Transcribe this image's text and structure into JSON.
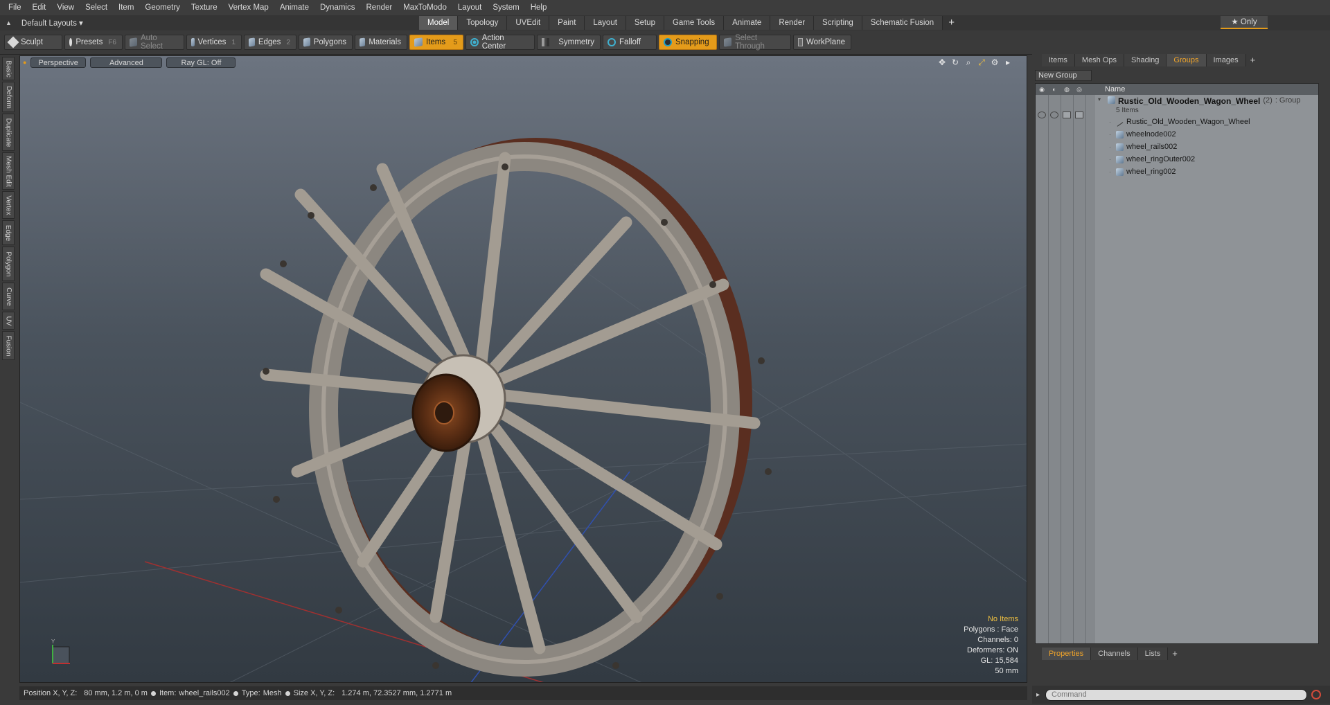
{
  "menu": [
    "File",
    "Edit",
    "View",
    "Select",
    "Item",
    "Geometry",
    "Texture",
    "Vertex Map",
    "Animate",
    "Dynamics",
    "Render",
    "MaxToModo",
    "Layout",
    "System",
    "Help"
  ],
  "layout_selector": "Default Layouts ▾",
  "tabs": [
    {
      "label": "Model",
      "active": true
    },
    {
      "label": "Topology"
    },
    {
      "label": "UVEdit"
    },
    {
      "label": "Paint"
    },
    {
      "label": "Layout"
    },
    {
      "label": "Setup"
    },
    {
      "label": "Game Tools"
    },
    {
      "label": "Animate"
    },
    {
      "label": "Render"
    },
    {
      "label": "Scripting"
    },
    {
      "label": "Schematic Fusion"
    }
  ],
  "tab_plus": "+",
  "only_button": "★ Only",
  "toolbar": {
    "sculpt": "Sculpt",
    "presets": "Presets",
    "presets_key": "F6",
    "auto_select": "Auto Select",
    "vertices": "Vertices",
    "vertices_key": "1",
    "edges": "Edges",
    "edges_key": "2",
    "polygons": "Polygons",
    "materials": "Materials",
    "items": "Items",
    "items_key": "5",
    "action_center": "Action Center",
    "symmetry": "Symmetry",
    "falloff": "Falloff",
    "snapping": "Snapping",
    "select_through": "Select Through",
    "workplane": "WorkPlane"
  },
  "left_tabs": [
    "Basic",
    "Deform",
    "Duplicate",
    "Mesh Edit",
    "Vertex",
    "Edge",
    "Polygon",
    "Curve",
    "UV",
    "Fusion"
  ],
  "viewport": {
    "view": "Perspective",
    "mode": "Advanced",
    "ray": "Ray GL: Off",
    "info": {
      "items": "No Items",
      "polygons": "Polygons : Face",
      "channels": "Channels: 0",
      "deformers": "Deformers: ON",
      "gl": "GL: 15,584",
      "scale": "50 mm"
    }
  },
  "status": {
    "position_label": "Position X, Y, Z:",
    "position_value": "80 mm, 1.2 m, 0 m",
    "item_label": "Item:",
    "item_value": "wheel_rails002",
    "type_label": "Type:",
    "type_value": "Mesh",
    "size_label": "Size X, Y, Z:",
    "size_value": "1.274 m, 72.3527 mm, 1.2771 m"
  },
  "right_panel": {
    "tabs": [
      {
        "label": "Items"
      },
      {
        "label": "Mesh Ops"
      },
      {
        "label": "Shading"
      },
      {
        "label": "Groups",
        "active": true
      },
      {
        "label": "Images"
      }
    ],
    "plus": "+",
    "new_group": "New Group",
    "column_name": "Name",
    "group": {
      "name": "Rustic_Old_Wooden_Wagon_Wheel",
      "count": "(2)",
      "kind": ": Group",
      "items": "5 Items"
    },
    "children": [
      "Rustic_Old_Wooden_Wagon_Wheel",
      "wheelnode002",
      "wheel_rails002",
      "wheel_ringOuter002",
      "wheel_ring002"
    ],
    "bottom_tabs": [
      {
        "label": "Properties",
        "active": true
      },
      {
        "label": "Channels"
      },
      {
        "label": "Lists"
      }
    ],
    "command_placeholder": "Command"
  }
}
